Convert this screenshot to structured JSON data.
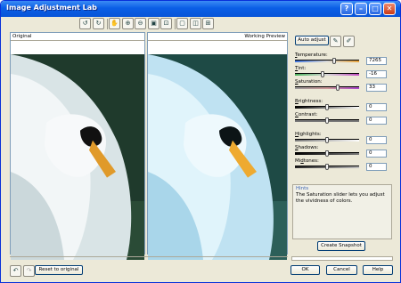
{
  "window": {
    "title": "Image Adjustment Lab"
  },
  "titlebar_buttons": [
    {
      "icon": "help-icon",
      "glyph": "?"
    },
    {
      "icon": "minimize-icon",
      "glyph": "–"
    },
    {
      "icon": "maximize-icon",
      "glyph": "□"
    },
    {
      "icon": "close-icon",
      "glyph": "✕"
    }
  ],
  "toolbar": [
    {
      "icon": "rotate-left-icon",
      "glyph": "↺"
    },
    {
      "icon": "rotate-right-icon",
      "glyph": "↻"
    },
    {
      "icon": "pan-hand-icon",
      "glyph": "✋"
    },
    {
      "icon": "zoom-in-icon",
      "glyph": "⊕"
    },
    {
      "icon": "zoom-out-icon",
      "glyph": "⊖"
    },
    {
      "icon": "zoom-to-fit-icon",
      "glyph": "▣"
    },
    {
      "icon": "actual-size-icon",
      "glyph": "⊡"
    },
    {
      "icon": "full-preview-icon",
      "glyph": "▢"
    },
    {
      "icon": "side-by-side-icon",
      "glyph": "◫"
    },
    {
      "icon": "split-preview-icon",
      "glyph": "⊞"
    }
  ],
  "panels": {
    "original": "Original",
    "preview": "Working Preview"
  },
  "auto_adjust": {
    "label": "Auto adjust"
  },
  "sliders": [
    {
      "label_pre": "",
      "label_key": "T",
      "label_post": "emperature:",
      "value": "7265",
      "pos": 0.62,
      "gradient": "linear-gradient(to right,#3a6fd8,#d7d7d7,#e6a23c)"
    },
    {
      "label_pre": "",
      "label_key": "T",
      "label_post": "int:",
      "value": "-16",
      "pos": 0.42,
      "gradient": "linear-gradient(to right,#49b15a,#d7d7d7,#c24ac2)"
    },
    {
      "label_pre": "",
      "label_key": "S",
      "label_post": "aturation:",
      "value": "33",
      "pos": 0.67,
      "gradient": "linear-gradient(to right,#999,#c99,#a4c)"
    },
    {
      "label_pre": "",
      "label_key": "B",
      "label_post": "rightness:",
      "value": "0",
      "pos": 0.5,
      "gradient": "linear-gradient(to right,#000,#fff)"
    },
    {
      "label_pre": "",
      "label_key": "C",
      "label_post": "ontrast:",
      "value": "0",
      "pos": 0.5,
      "gradient": "linear-gradient(to right,#777,#777)"
    },
    {
      "label_pre": "",
      "label_key": "H",
      "label_post": "ighlights:",
      "value": "0",
      "pos": 0.5,
      "gradient": "linear-gradient(to right,#777,#fff)"
    },
    {
      "label_pre": "",
      "label_key": "S",
      "label_post": "hadows:",
      "value": "0",
      "pos": 0.5,
      "gradient": "linear-gradient(to right,#000,#777)"
    },
    {
      "label_pre": "Mi",
      "label_key": "d",
      "label_post": "tones:",
      "value": "0",
      "pos": 0.5,
      "gradient": "linear-gradient(to right,#222,#bbb)"
    }
  ],
  "hints": {
    "title": "Hints",
    "text": "The Saturation slider lets you adjust the vividness of colors."
  },
  "create_snapshot": {
    "label": "Create Snapshot"
  },
  "reset": {
    "label": "Reset to original"
  },
  "footer": {
    "ok": "OK",
    "cancel": "Cancel",
    "help": "Help"
  }
}
